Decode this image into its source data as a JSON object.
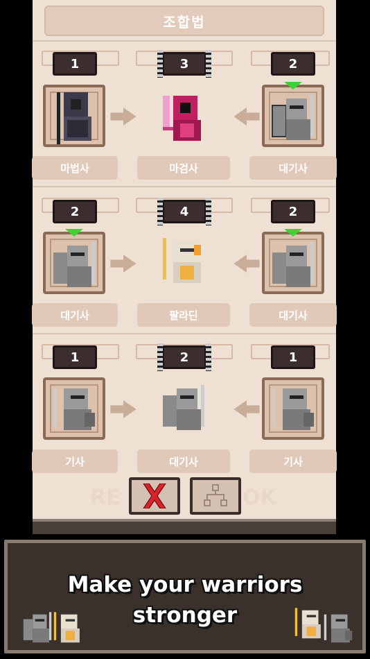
{
  "header": {
    "title": "조합법"
  },
  "recipes": [
    {
      "left": {
        "count": "1",
        "name": "마법사",
        "type": "mage"
      },
      "result": {
        "count": "3",
        "name": "마검사",
        "type": "magicswordsman"
      },
      "right": {
        "count": "2",
        "name": "대기사",
        "type": "greatknight"
      }
    },
    {
      "left": {
        "count": "2",
        "name": "대기사",
        "type": "greatknight"
      },
      "result": {
        "count": "4",
        "name": "팔라딘",
        "type": "paladin"
      },
      "right": {
        "count": "2",
        "name": "대기사",
        "type": "greatknight"
      }
    },
    {
      "left": {
        "count": "1",
        "name": "기사",
        "type": "knight"
      },
      "result": {
        "count": "2",
        "name": "대기사",
        "type": "greatknight"
      },
      "right": {
        "count": "1",
        "name": "기사",
        "type": "knight"
      }
    }
  ],
  "buttons": {
    "close_icon": "close-x-icon",
    "tree_icon": "recipe-tree-icon"
  },
  "ghost_text": {
    "left": "RE",
    "right": "OK"
  },
  "banner": {
    "line1": "Make your warriors",
    "line2": "stronger"
  },
  "colors": {
    "panel": "#eee0d3",
    "badge": "#3c2e2e",
    "banner": "#3a302c",
    "close_red": "#d8232a",
    "upgrade_green": "#3fd236"
  }
}
